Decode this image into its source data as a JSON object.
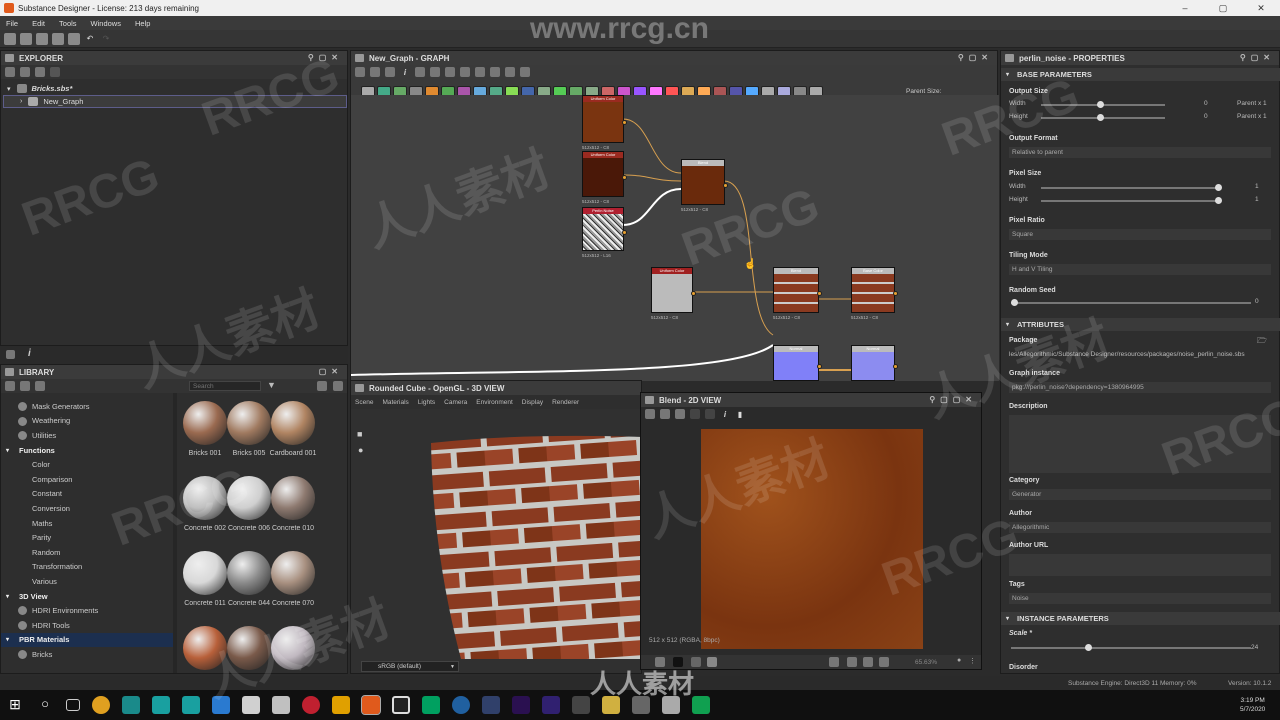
{
  "window": {
    "title": "Substance Designer - License: 213 days remaining",
    "controls": [
      "–",
      "▢",
      "✕"
    ]
  },
  "menu": [
    "File",
    "Edit",
    "Tools",
    "Windows",
    "Help"
  ],
  "explorer": {
    "title": "EXPLORER",
    "package": "Bricks.sbs*",
    "graph": "New_Graph"
  },
  "library": {
    "title": "LIBRARY",
    "search_placeholder": "Search",
    "categories": [
      {
        "label": "Mask Generators",
        "level": 1
      },
      {
        "label": "Weathering",
        "level": 1
      },
      {
        "label": "Utilities",
        "level": 1
      },
      {
        "label": "Functions",
        "level": 0
      },
      {
        "label": "Color",
        "level": 2
      },
      {
        "label": "Comparison",
        "level": 2
      },
      {
        "label": "Constant",
        "level": 2
      },
      {
        "label": "Conversion",
        "level": 2
      },
      {
        "label": "Maths",
        "level": 2
      },
      {
        "label": "Parity",
        "level": 2
      },
      {
        "label": "Random",
        "level": 2
      },
      {
        "label": "Transformation",
        "level": 2
      },
      {
        "label": "Various",
        "level": 2
      },
      {
        "label": "3D View",
        "level": 0
      },
      {
        "label": "HDRI Environments",
        "level": 1
      },
      {
        "label": "HDRI Tools",
        "level": 1
      },
      {
        "label": "PBR Materials",
        "level": 0
      },
      {
        "label": "Bricks",
        "level": 1
      }
    ],
    "thumbnails": [
      {
        "label": "Bricks 001",
        "color": "#9a6a50"
      },
      {
        "label": "Bricks 005",
        "color": "#a07a60"
      },
      {
        "label": "Cardboard 001",
        "color": "#b08462"
      },
      {
        "label": "Concrete 002",
        "color": "#bfbfbf"
      },
      {
        "label": "Concrete 006",
        "color": "#cfcfcf"
      },
      {
        "label": "Concrete 010",
        "color": "#8e7a70"
      },
      {
        "label": "Concrete 011",
        "color": "#d8d8d8"
      },
      {
        "label": "Concrete 044",
        "color": "#8a8a8a"
      },
      {
        "label": "Concrete 070",
        "color": "#a89080"
      },
      {
        "label": "",
        "color": "#b8603a"
      },
      {
        "label": "",
        "color": "#7a5a4a"
      },
      {
        "label": "",
        "color": "#c0b8c0"
      }
    ]
  },
  "graph": {
    "title": "New_Graph - GRAPH",
    "parent_size_label": "Parent Size:",
    "nodes": [
      {
        "title": "Uniform Color",
        "size": "512x512 - C8"
      },
      {
        "title": "Uniform Color",
        "size": "512x512 - C8"
      },
      {
        "title": "Perlin Noise",
        "size": "512x512 - L16"
      },
      {
        "title": "Blend",
        "size": "512x512 - C8"
      },
      {
        "title": "Uniform Color",
        "size": "512x512 - C8"
      },
      {
        "title": "Blend",
        "size": "512x512 - C8"
      },
      {
        "title": "Base Color",
        "size": "512x512 - C8"
      },
      {
        "title": "Normal",
        "size": ""
      },
      {
        "title": "Normal",
        "size": ""
      }
    ]
  },
  "view3d": {
    "title": "Rounded Cube - OpenGL - 3D VIEW",
    "menu": [
      "Scene",
      "Materials",
      "Lights",
      "Camera",
      "Environment",
      "Display",
      "Renderer"
    ],
    "colorspace": "sRGB (default)"
  },
  "view2d": {
    "title": "Blend - 2D VIEW",
    "info": "512 x 512 (RGBA, 8bpc)",
    "zoom": "65.63%"
  },
  "properties": {
    "title": "perlin_noise - PROPERTIES",
    "base_section": "BASE PARAMETERS",
    "output_size": "Output Size",
    "width": "Width",
    "height": "Height",
    "os_w_val": "0",
    "os_h_val": "0",
    "os_w_parent": "Parent x 1",
    "os_h_parent": "Parent x 1",
    "output_format": "Output Format",
    "output_format_value": "Relative to parent",
    "pixel_size": "Pixel Size",
    "ps_w_val": "1",
    "ps_h_val": "1",
    "pixel_ratio": "Pixel Ratio",
    "pixel_ratio_value": "Square",
    "tiling_mode": "Tiling Mode",
    "tiling_mode_value": "H and V Tiling",
    "random_seed": "Random Seed",
    "random_seed_val": "0",
    "attributes_section": "ATTRIBUTES",
    "package": "Package",
    "package_value": "les/Allegorithmic/Substance Designer/resources/packages/noise_perlin_noise.sbs",
    "graph_instance": "Graph instance",
    "graph_instance_value": "pkg:///perlin_noise?dependency=1380964995",
    "description": "Description",
    "category": "Category",
    "category_value": "Generator",
    "author": "Author",
    "author_value": "Allegorithmic",
    "author_url": "Author URL",
    "tags": "Tags",
    "tags_value": "Noise",
    "instance_section": "INSTANCE PARAMETERS",
    "scale": "Scale *",
    "scale_val": "24",
    "disorder": "Disorder"
  },
  "statusbar": {
    "engine": "Substance Engine: Direct3D 11  Memory: 0%",
    "version": "Version: 10.1.2"
  },
  "taskbar": {
    "time": "3:19 PM",
    "date": "5/7/2020"
  },
  "watermarks": [
    "www.rrcg.cn",
    "RRCG",
    "人人素材"
  ],
  "colors": {
    "accent": "#e05a1c",
    "brick": "#8a3a1a",
    "normal": "#7c7cf0"
  }
}
